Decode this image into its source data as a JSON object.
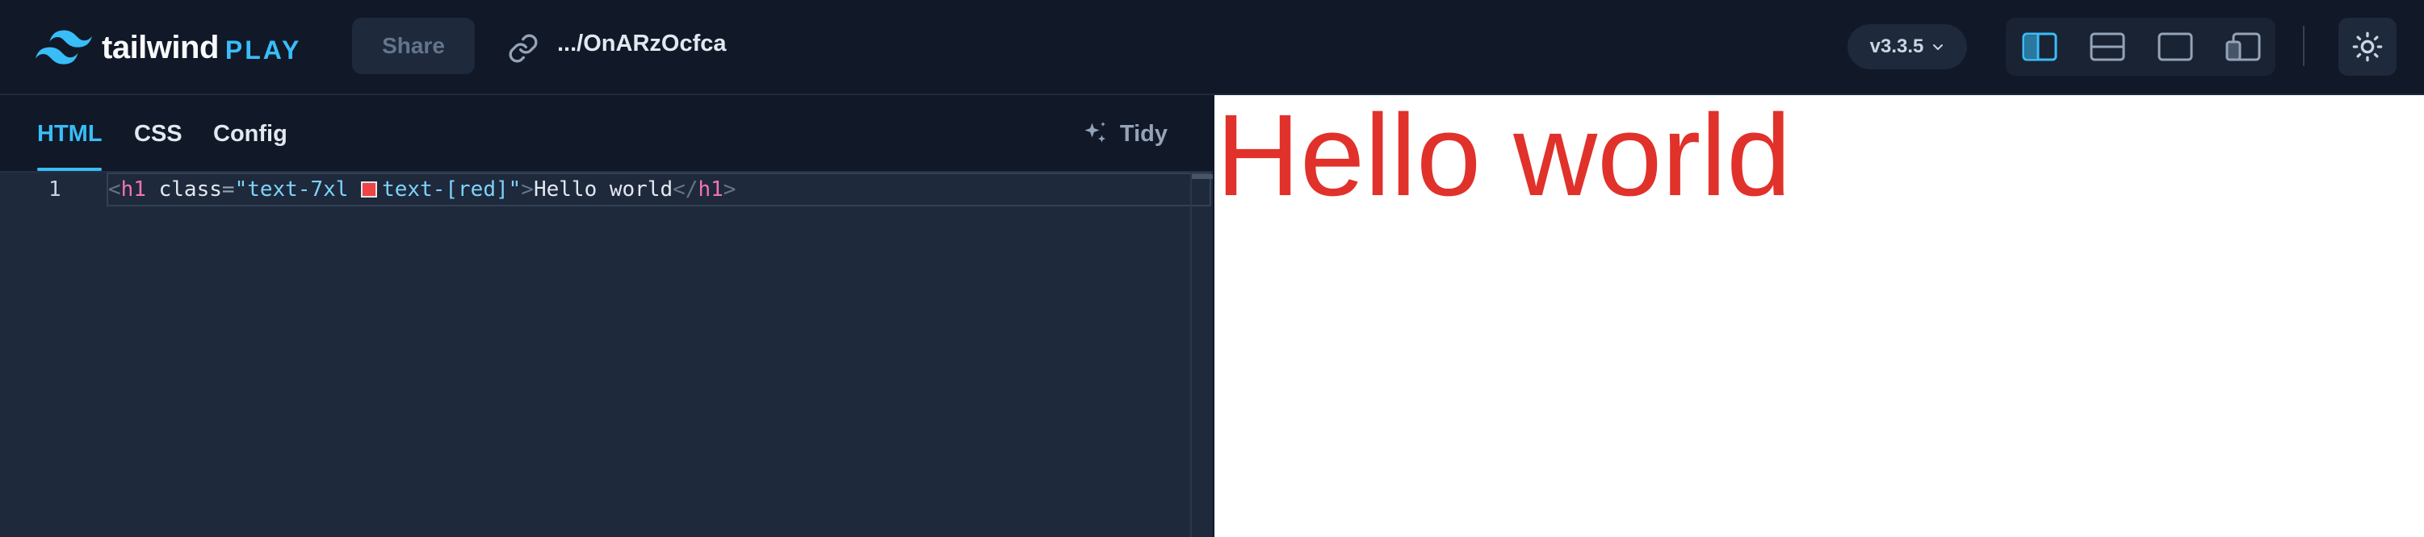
{
  "app": {
    "brand": "tailwind",
    "brand_suffix": "PLAY",
    "share_label": "Share",
    "url_path": ".../OnARzOcfca",
    "version": "v3.3.5"
  },
  "layout_modes": [
    {
      "name": "split-vertical-icon",
      "active": true
    },
    {
      "name": "split-horizontal-icon",
      "active": false
    },
    {
      "name": "preview-only-icon",
      "active": false
    },
    {
      "name": "responsive-icon",
      "active": false
    }
  ],
  "editor": {
    "tabs": [
      {
        "label": "HTML",
        "active": true
      },
      {
        "label": "CSS",
        "active": false
      },
      {
        "label": "Config",
        "active": false
      }
    ],
    "tidy_label": "Tidy",
    "line_number": "1",
    "code": {
      "lt": "<",
      "tag_open": "h1",
      "attr": "class",
      "eq": "=",
      "class_part1": "\"text-7xl ",
      "class_part2": "text-[red]\"",
      "gt": ">",
      "text": "Hello world",
      "close_lt": "</",
      "tag_close": "h1",
      "close_gt": ">"
    },
    "swatch_color": "#ef4444"
  },
  "preview": {
    "heading": "Hello world",
    "heading_color": "#e1312b"
  },
  "colors": {
    "accent": "#38bdf8",
    "background": "#111827"
  }
}
